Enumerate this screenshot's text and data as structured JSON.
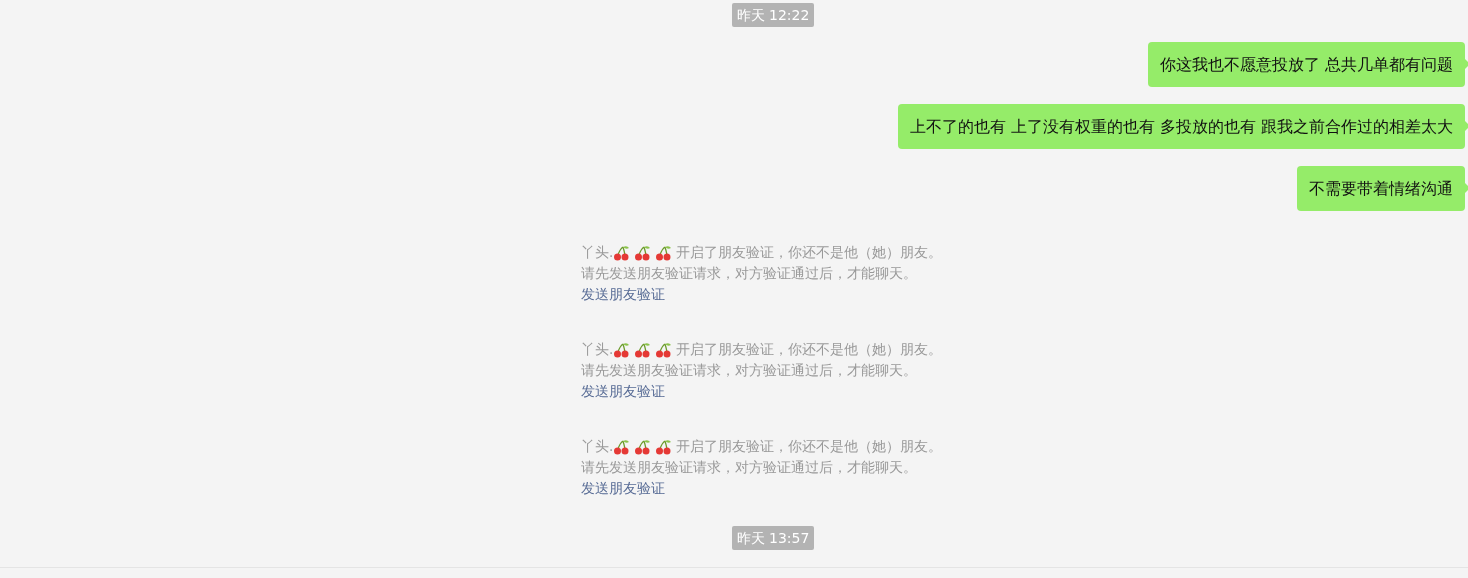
{
  "messages": [
    {
      "kind": "time",
      "text": "昨天 12:22"
    },
    {
      "kind": "sent",
      "text": "你这我也不愿意投放了 总共几单都有问题"
    },
    {
      "kind": "sent",
      "text": "上不了的也有 上了没有权重的也有 多投放的也有 跟我之前合作过的相差太大"
    },
    {
      "kind": "sent",
      "text": "不需要带着情绪沟通"
    },
    {
      "kind": "notice",
      "name": "丫头.",
      "text": "开启了朋友验证，你还不是他（她）朋友。",
      "request": "请先发送朋友验证请求，对方验证通过后，才能聊天。",
      "link": "发送朋友验证"
    },
    {
      "kind": "notice",
      "name": "丫头.",
      "text": "开启了朋友验证，你还不是他（她）朋友。",
      "request": "请先发送朋友验证请求，对方验证通过后，才能聊天。",
      "link": "发送朋友验证"
    },
    {
      "kind": "notice",
      "name": "丫头.",
      "text": "开启了朋友验证，你还不是他（她）朋友。",
      "request": "请先发送朋友验证请求，对方验证通过后，才能聊天。",
      "link": "发送朋友验证"
    },
    {
      "kind": "time",
      "text": "昨天 13:57"
    }
  ]
}
